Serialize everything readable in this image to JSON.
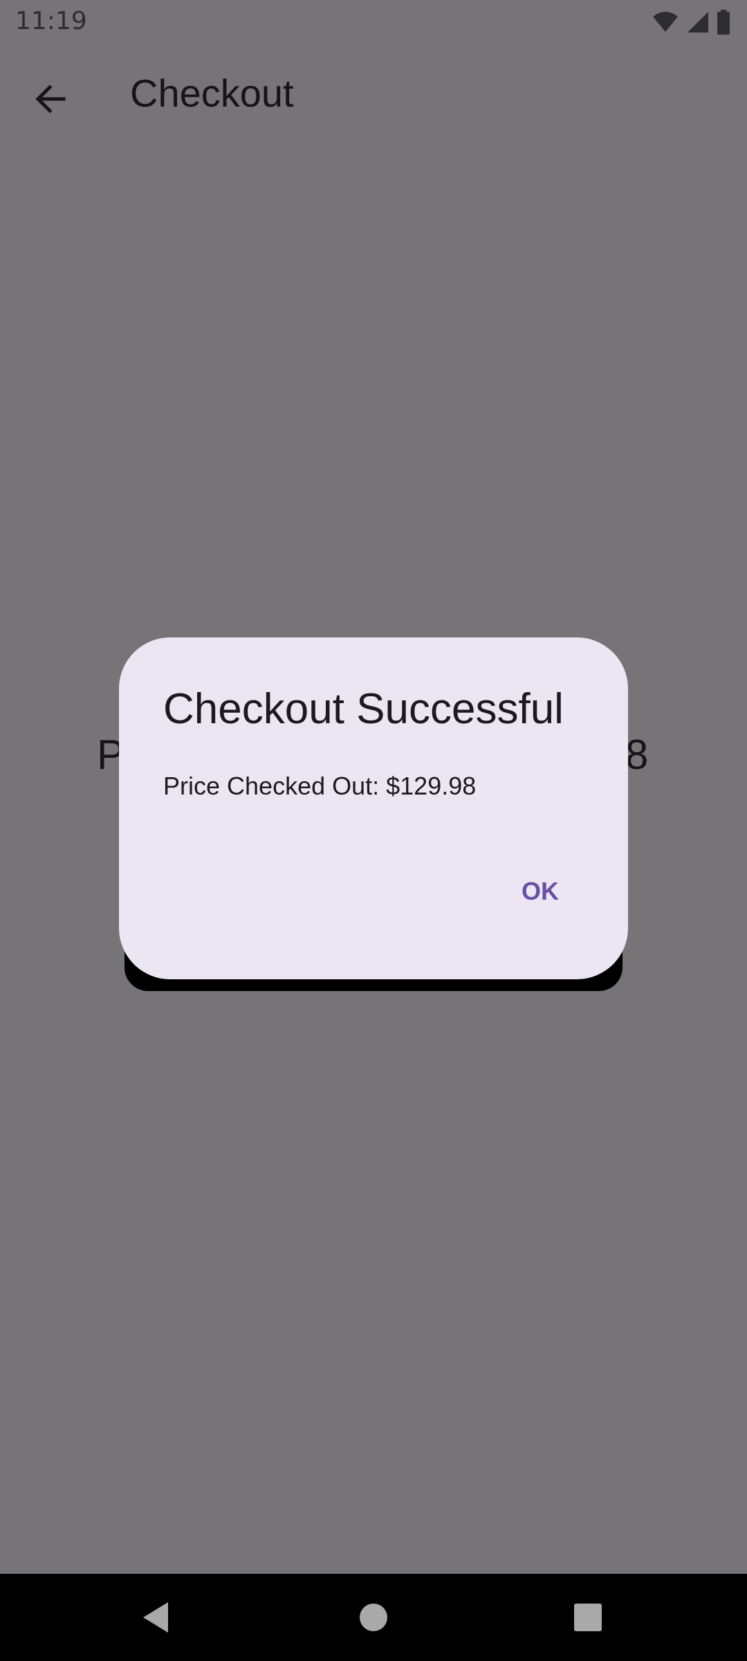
{
  "status_bar": {
    "time": "11:19",
    "icons": [
      "wifi-icon",
      "signal-icon",
      "battery-icon"
    ]
  },
  "app_bar": {
    "title": "Checkout",
    "back_icon": "arrow-back-icon"
  },
  "background": {
    "price_text_left": "P",
    "price_text_right": "8"
  },
  "dialog": {
    "title": "Checkout Successful",
    "message": "Price Checked Out: $129.98",
    "confirm_label": "OK"
  },
  "nav_bar": {
    "icons": [
      "nav-back-icon",
      "nav-home-icon",
      "nav-recents-icon"
    ]
  },
  "colors": {
    "scrim": "#767477",
    "dialog_bg": "#ece6f2",
    "accent": "#6750a4",
    "nav_bar": "#000000"
  }
}
